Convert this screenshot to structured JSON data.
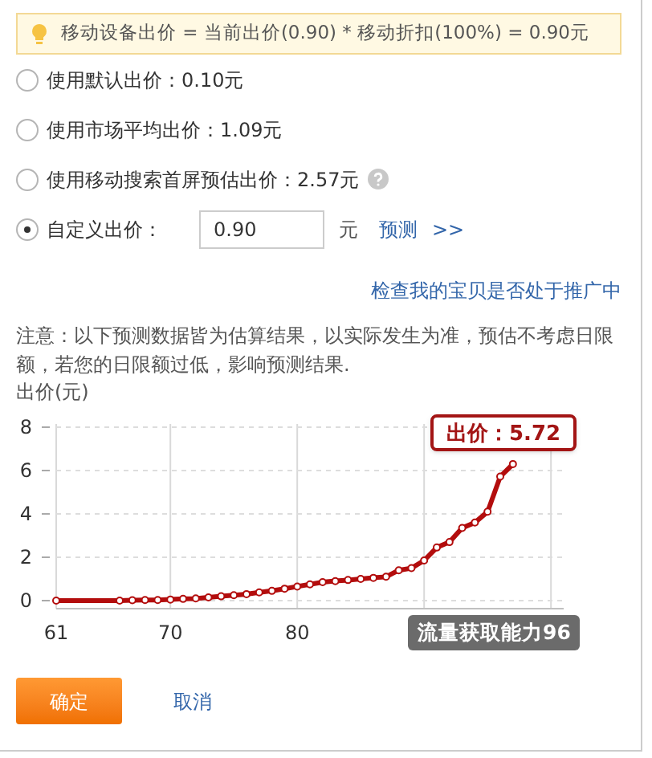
{
  "formula_tip": "移动设备出价 = 当前出价(0.90) * 移动折扣(100%) = 0.90元",
  "options": [
    {
      "kind": "plain",
      "label": "使用默认出价：0.10元",
      "selected": false
    },
    {
      "kind": "plain",
      "label": "使用市场平均出价：1.09元",
      "selected": false
    },
    {
      "kind": "help",
      "label": "使用移动搜索首屏预估出价：2.57元",
      "selected": false
    },
    {
      "kind": "custom",
      "label": "自定义出价：",
      "value": "0.90",
      "unit": "元",
      "link": "预测",
      "more": ">>",
      "selected": true
    }
  ],
  "check_link": "检查我的宝贝是否处于推广中",
  "note": "注意：以下预测数据皆为估算结果，以实际发生为准，预估不考虑日限额，若您的日限额过低，影响预测结果.",
  "chart_unit": "出价(元)",
  "chart_data": {
    "type": "line",
    "x": [
      61,
      66,
      67,
      68,
      69,
      70,
      71,
      72,
      73,
      74,
      75,
      76,
      77,
      78,
      79,
      80,
      81,
      82,
      83,
      84,
      85,
      86,
      87,
      88,
      89,
      90,
      91,
      92,
      93,
      94,
      95,
      96,
      97
    ],
    "series": [
      {
        "color": "#b30d0d",
        "marker": "circle",
        "values": [
          0,
          0,
          0.02,
          0.03,
          0.03,
          0.05,
          0.08,
          0.1,
          0.15,
          0.2,
          0.25,
          0.3,
          0.38,
          0.45,
          0.55,
          0.65,
          0.75,
          0.85,
          0.9,
          0.95,
          1.0,
          1.05,
          1.1,
          1.4,
          1.5,
          1.85,
          2.45,
          2.7,
          3.35,
          3.6,
          4.1,
          5.72,
          6.3
        ]
      }
    ],
    "grid": true,
    "xlim": [
      61,
      101
    ],
    "ylim": [
      0,
      8
    ],
    "xticks": [
      61,
      70,
      80
    ],
    "yticks": [
      0,
      2,
      4,
      6,
      8
    ],
    "annotations": [
      "出价：5.72",
      "流量获取能力96"
    ]
  },
  "buttons": [
    {
      "label": "确定",
      "kind": "primary"
    },
    {
      "label": "取消",
      "kind": "link"
    }
  ]
}
